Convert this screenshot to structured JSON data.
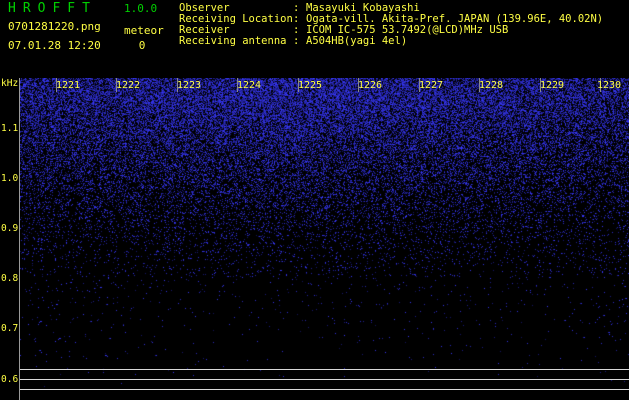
{
  "header": {
    "app_title": "HROFFT",
    "app_version": "1.0.0",
    "file_name": "0701281220.png",
    "date_time": "07.01.28 12:20",
    "meteor_label": "meteor",
    "meteor_count": "0"
  },
  "info": [
    {
      "key": "Observer",
      "sep": ":",
      "value": "Masayuki Kobayashi"
    },
    {
      "key": "Receiving Location",
      "sep": ":",
      "value": "Ogata-vill. Akita-Pref. JAPAN (139.96E, 40.02N)"
    },
    {
      "key": "Receiver",
      "sep": ":",
      "value": "ICOM IC-575 53.7492(@LCD)MHz USB"
    },
    {
      "key": "Receiving antenna",
      "sep": ":",
      "value": "A504HB(yagi 4el)"
    }
  ],
  "spectrogram": {
    "unit_label": "kHz",
    "freq_ticks": [
      "1.1",
      "1.0",
      "0.9",
      "0.8",
      "0.7",
      "0.6"
    ],
    "time_labels": [
      "1221",
      "1222",
      "1223",
      "1224",
      "1225",
      "1226",
      "1227",
      "1228",
      "1229",
      "1230"
    ],
    "noise_color": "#2a2aff",
    "axis_color": "#ffff44"
  }
}
